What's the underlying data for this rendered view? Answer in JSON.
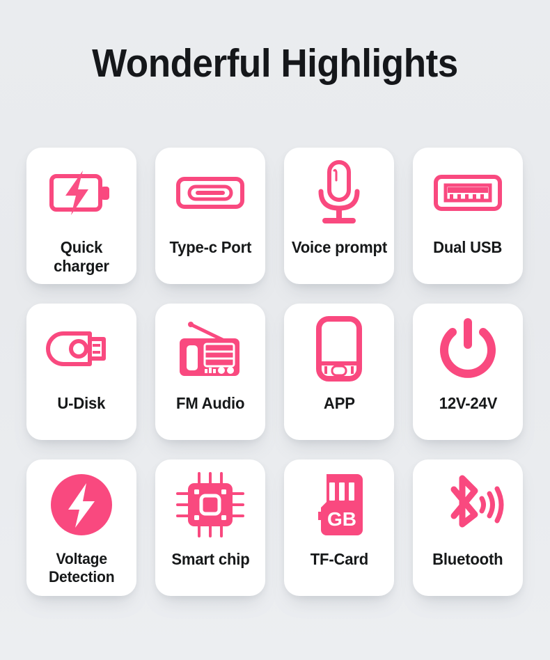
{
  "page": {
    "title": "Wonderful Highlights",
    "background_color": "#e9ebee",
    "accent_color": "#f9497f",
    "card_color": "#ffffff",
    "label_color": "#161819"
  },
  "features": [
    {
      "label": "Quick charger",
      "icon": "battery-bolt-icon"
    },
    {
      "label": "Type-c Port",
      "icon": "usb-c-port-icon"
    },
    {
      "label": "Voice prompt",
      "icon": "microphone-icon"
    },
    {
      "label": "Dual USB",
      "icon": "usb-a-port-icon"
    },
    {
      "label": "U-Disk",
      "icon": "usb-flash-drive-icon"
    },
    {
      "label": "FM Audio",
      "icon": "radio-icon"
    },
    {
      "label": "APP",
      "icon": "smartphone-icon"
    },
    {
      "label": "12V-24V",
      "icon": "power-button-icon"
    },
    {
      "label": "Voltage\nDetection",
      "icon": "bolt-circle-icon"
    },
    {
      "label": "Smart chip",
      "icon": "cpu-chip-icon"
    },
    {
      "label": "TF-Card",
      "icon": "memory-card-gb-icon",
      "icon_text": "GB"
    },
    {
      "label": "Bluetooth",
      "icon": "bluetooth-signal-icon"
    }
  ]
}
